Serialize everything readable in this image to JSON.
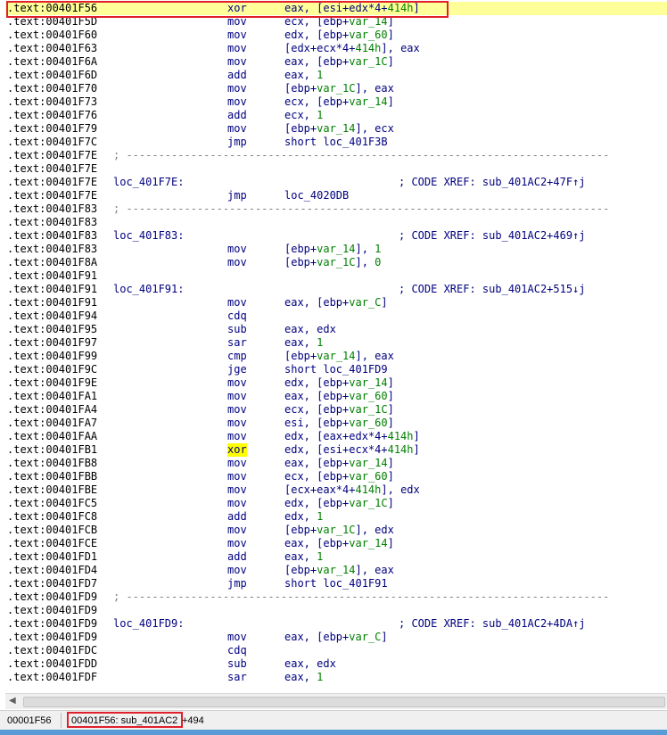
{
  "listing": {
    "rows": [
      {
        "addr": ".text:00401F56",
        "lbl": "",
        "mn": "xor",
        "op": "eax, [esi+edx*4+414h]",
        "cm": "",
        "sep": "",
        "sel": true,
        "hlmn": false
      },
      {
        "addr": ".text:00401F5D",
        "lbl": "",
        "mn": "mov",
        "op": "ecx, [ebp+var_14]",
        "cm": "",
        "sep": "",
        "sel": false,
        "hlmn": false
      },
      {
        "addr": ".text:00401F60",
        "lbl": "",
        "mn": "mov",
        "op": "edx, [ebp+var_60]",
        "cm": "",
        "sep": "",
        "sel": false,
        "hlmn": false
      },
      {
        "addr": ".text:00401F63",
        "lbl": "",
        "mn": "mov",
        "op": "[edx+ecx*4+414h], eax",
        "cm": "",
        "sep": "",
        "sel": false,
        "hlmn": false
      },
      {
        "addr": ".text:00401F6A",
        "lbl": "",
        "mn": "mov",
        "op": "eax, [ebp+var_1C]",
        "cm": "",
        "sep": "",
        "sel": false,
        "hlmn": false
      },
      {
        "addr": ".text:00401F6D",
        "lbl": "",
        "mn": "add",
        "op": "eax, 1",
        "cm": "",
        "sep": "",
        "sel": false,
        "hlmn": false
      },
      {
        "addr": ".text:00401F70",
        "lbl": "",
        "mn": "mov",
        "op": "[ebp+var_1C], eax",
        "cm": "",
        "sep": "",
        "sel": false,
        "hlmn": false
      },
      {
        "addr": ".text:00401F73",
        "lbl": "",
        "mn": "mov",
        "op": "ecx, [ebp+var_14]",
        "cm": "",
        "sep": "",
        "sel": false,
        "hlmn": false
      },
      {
        "addr": ".text:00401F76",
        "lbl": "",
        "mn": "add",
        "op": "ecx, 1",
        "cm": "",
        "sep": "",
        "sel": false,
        "hlmn": false
      },
      {
        "addr": ".text:00401F79",
        "lbl": "",
        "mn": "mov",
        "op": "[ebp+var_14], ecx",
        "cm": "",
        "sep": "",
        "sel": false,
        "hlmn": false
      },
      {
        "addr": ".text:00401F7C",
        "lbl": "",
        "mn": "jmp",
        "op": "short loc_401F3B",
        "cm": "",
        "sep": "",
        "sel": false,
        "hlmn": false
      },
      {
        "addr": ".text:00401F7E",
        "lbl": "",
        "mn": "",
        "op": "",
        "cm": "",
        "sep": "; ---------------------------------------------------------------------------",
        "sel": false,
        "hlmn": false
      },
      {
        "addr": ".text:00401F7E",
        "lbl": "",
        "mn": "",
        "op": "",
        "cm": "",
        "sep": "",
        "sel": false,
        "hlmn": false
      },
      {
        "addr": ".text:00401F7E",
        "lbl": "loc_401F7E:",
        "mn": "",
        "op": "",
        "cm": "; CODE XREF: sub_401AC2+47F↑j",
        "sep": "",
        "sel": false,
        "hlmn": false
      },
      {
        "addr": ".text:00401F7E",
        "lbl": "",
        "mn": "jmp",
        "op": "loc_4020DB",
        "cm": "",
        "sep": "",
        "sel": false,
        "hlmn": false
      },
      {
        "addr": ".text:00401F83",
        "lbl": "",
        "mn": "",
        "op": "",
        "cm": "",
        "sep": "; ---------------------------------------------------------------------------",
        "sel": false,
        "hlmn": false
      },
      {
        "addr": ".text:00401F83",
        "lbl": "",
        "mn": "",
        "op": "",
        "cm": "",
        "sep": "",
        "sel": false,
        "hlmn": false
      },
      {
        "addr": ".text:00401F83",
        "lbl": "loc_401F83:",
        "mn": "",
        "op": "",
        "cm": "; CODE XREF: sub_401AC2+469↑j",
        "sep": "",
        "sel": false,
        "hlmn": false
      },
      {
        "addr": ".text:00401F83",
        "lbl": "",
        "mn": "mov",
        "op": "[ebp+var_14], 1",
        "cm": "",
        "sep": "",
        "sel": false,
        "hlmn": false
      },
      {
        "addr": ".text:00401F8A",
        "lbl": "",
        "mn": "mov",
        "op": "[ebp+var_1C], 0",
        "cm": "",
        "sep": "",
        "sel": false,
        "hlmn": false
      },
      {
        "addr": ".text:00401F91",
        "lbl": "",
        "mn": "",
        "op": "",
        "cm": "",
        "sep": "",
        "sel": false,
        "hlmn": false
      },
      {
        "addr": ".text:00401F91",
        "lbl": "loc_401F91:",
        "mn": "",
        "op": "",
        "cm": "; CODE XREF: sub_401AC2+515↓j",
        "sep": "",
        "sel": false,
        "hlmn": false
      },
      {
        "addr": ".text:00401F91",
        "lbl": "",
        "mn": "mov",
        "op": "eax, [ebp+var_C]",
        "cm": "",
        "sep": "",
        "sel": false,
        "hlmn": false
      },
      {
        "addr": ".text:00401F94",
        "lbl": "",
        "mn": "cdq",
        "op": "",
        "cm": "",
        "sep": "",
        "sel": false,
        "hlmn": false
      },
      {
        "addr": ".text:00401F95",
        "lbl": "",
        "mn": "sub",
        "op": "eax, edx",
        "cm": "",
        "sep": "",
        "sel": false,
        "hlmn": false
      },
      {
        "addr": ".text:00401F97",
        "lbl": "",
        "mn": "sar",
        "op": "eax, 1",
        "cm": "",
        "sep": "",
        "sel": false,
        "hlmn": false
      },
      {
        "addr": ".text:00401F99",
        "lbl": "",
        "mn": "cmp",
        "op": "[ebp+var_14], eax",
        "cm": "",
        "sep": "",
        "sel": false,
        "hlmn": false
      },
      {
        "addr": ".text:00401F9C",
        "lbl": "",
        "mn": "jge",
        "op": "short loc_401FD9",
        "cm": "",
        "sep": "",
        "sel": false,
        "hlmn": false
      },
      {
        "addr": ".text:00401F9E",
        "lbl": "",
        "mn": "mov",
        "op": "edx, [ebp+var_14]",
        "cm": "",
        "sep": "",
        "sel": false,
        "hlmn": false
      },
      {
        "addr": ".text:00401FA1",
        "lbl": "",
        "mn": "mov",
        "op": "eax, [ebp+var_60]",
        "cm": "",
        "sep": "",
        "sel": false,
        "hlmn": false
      },
      {
        "addr": ".text:00401FA4",
        "lbl": "",
        "mn": "mov",
        "op": "ecx, [ebp+var_1C]",
        "cm": "",
        "sep": "",
        "sel": false,
        "hlmn": false
      },
      {
        "addr": ".text:00401FA7",
        "lbl": "",
        "mn": "mov",
        "op": "esi, [ebp+var_60]",
        "cm": "",
        "sep": "",
        "sel": false,
        "hlmn": false
      },
      {
        "addr": ".text:00401FAA",
        "lbl": "",
        "mn": "mov",
        "op": "edx, [eax+edx*4+414h]",
        "cm": "",
        "sep": "",
        "sel": false,
        "hlmn": false
      },
      {
        "addr": ".text:00401FB1",
        "lbl": "",
        "mn": "xor",
        "op": "edx, [esi+ecx*4+414h]",
        "cm": "",
        "sep": "",
        "sel": false,
        "hlmn": true
      },
      {
        "addr": ".text:00401FB8",
        "lbl": "",
        "mn": "mov",
        "op": "eax, [ebp+var_14]",
        "cm": "",
        "sep": "",
        "sel": false,
        "hlmn": false
      },
      {
        "addr": ".text:00401FBB",
        "lbl": "",
        "mn": "mov",
        "op": "ecx, [ebp+var_60]",
        "cm": "",
        "sep": "",
        "sel": false,
        "hlmn": false
      },
      {
        "addr": ".text:00401FBE",
        "lbl": "",
        "mn": "mov",
        "op": "[ecx+eax*4+414h], edx",
        "cm": "",
        "sep": "",
        "sel": false,
        "hlmn": false
      },
      {
        "addr": ".text:00401FC5",
        "lbl": "",
        "mn": "mov",
        "op": "edx, [ebp+var_1C]",
        "cm": "",
        "sep": "",
        "sel": false,
        "hlmn": false
      },
      {
        "addr": ".text:00401FC8",
        "lbl": "",
        "mn": "add",
        "op": "edx, 1",
        "cm": "",
        "sep": "",
        "sel": false,
        "hlmn": false
      },
      {
        "addr": ".text:00401FCB",
        "lbl": "",
        "mn": "mov",
        "op": "[ebp+var_1C], edx",
        "cm": "",
        "sep": "",
        "sel": false,
        "hlmn": false
      },
      {
        "addr": ".text:00401FCE",
        "lbl": "",
        "mn": "mov",
        "op": "eax, [ebp+var_14]",
        "cm": "",
        "sep": "",
        "sel": false,
        "hlmn": false
      },
      {
        "addr": ".text:00401FD1",
        "lbl": "",
        "mn": "add",
        "op": "eax, 1",
        "cm": "",
        "sep": "",
        "sel": false,
        "hlmn": false
      },
      {
        "addr": ".text:00401FD4",
        "lbl": "",
        "mn": "mov",
        "op": "[ebp+var_14], eax",
        "cm": "",
        "sep": "",
        "sel": false,
        "hlmn": false
      },
      {
        "addr": ".text:00401FD7",
        "lbl": "",
        "mn": "jmp",
        "op": "short loc_401F91",
        "cm": "",
        "sep": "",
        "sel": false,
        "hlmn": false
      },
      {
        "addr": ".text:00401FD9",
        "lbl": "",
        "mn": "",
        "op": "",
        "cm": "",
        "sep": "; ---------------------------------------------------------------------------",
        "sel": false,
        "hlmn": false
      },
      {
        "addr": ".text:00401FD9",
        "lbl": "",
        "mn": "",
        "op": "",
        "cm": "",
        "sep": "",
        "sel": false,
        "hlmn": false
      },
      {
        "addr": ".text:00401FD9",
        "lbl": "loc_401FD9:",
        "mn": "",
        "op": "",
        "cm": "; CODE XREF: sub_401AC2+4DA↑j",
        "sep": "",
        "sel": false,
        "hlmn": false
      },
      {
        "addr": ".text:00401FD9",
        "lbl": "",
        "mn": "mov",
        "op": "eax, [ebp+var_C]",
        "cm": "",
        "sep": "",
        "sel": false,
        "hlmn": false
      },
      {
        "addr": ".text:00401FDC",
        "lbl": "",
        "mn": "cdq",
        "op": "",
        "cm": "",
        "sep": "",
        "sel": false,
        "hlmn": false
      },
      {
        "addr": ".text:00401FDD",
        "lbl": "",
        "mn": "sub",
        "op": "eax, edx",
        "cm": "",
        "sep": "",
        "sel": false,
        "hlmn": false
      },
      {
        "addr": ".text:00401FDF",
        "lbl": "",
        "mn": "sar",
        "op": "eax, 1",
        "cm": "",
        "sep": "",
        "sel": false,
        "hlmn": false
      }
    ]
  },
  "statusbar": {
    "offset": "00001F56",
    "location": "00401F56: sub_401AC2",
    "location_suffix": "+494"
  },
  "colors": {
    "selection": "#ffff99",
    "highlight": "#ffff00",
    "annotation_box": "#e0202a",
    "code_text": "#000080",
    "variable": "#008000"
  }
}
